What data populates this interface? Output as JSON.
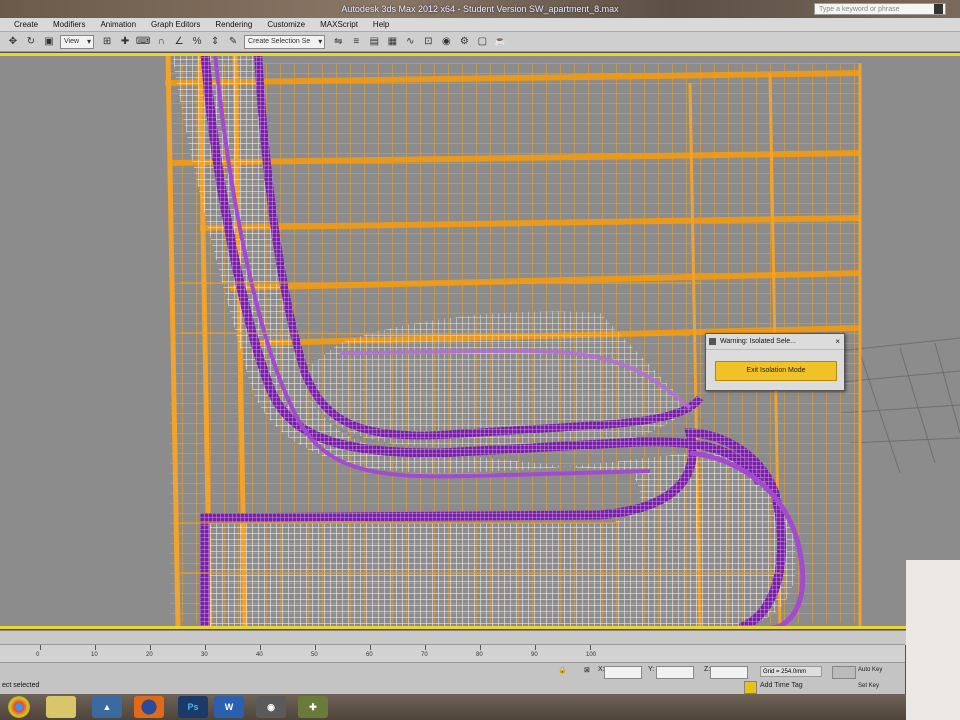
{
  "window": {
    "title": "Autodesk 3ds Max  2012 x64    - Student Version     SW_apartment_8.max"
  },
  "help_search": {
    "placeholder": "Type a keyword or phrase"
  },
  "menubar": {
    "items": [
      "Create",
      "Modifiers",
      "Animation",
      "Graph Editors",
      "Rendering",
      "Customize",
      "MAXScript",
      "Help"
    ]
  },
  "toolbar": {
    "view_dropdown": "View",
    "selection_set": "Create Selection Se"
  },
  "isolation_dialog": {
    "title": "Warning: Isolated Sele...",
    "close_label": "×",
    "button_label": "Exit Isolation Mode"
  },
  "timeline": {
    "ticks": [
      "0",
      "10",
      "20",
      "30",
      "40",
      "50",
      "60",
      "70",
      "80",
      "90",
      "100"
    ]
  },
  "statusbar": {
    "prompt": "ect selected",
    "x_label": "X:",
    "y_label": "Y:",
    "z_label": "Z:",
    "grid": "Grid = 254.0mm",
    "time_tag": "Add Time Tag",
    "auto_key": "Auto Key",
    "set_key": "Set Key"
  },
  "taskbar": {
    "apps": [
      "chrome",
      "folder",
      "3dsmax",
      "firefox",
      "photoshop",
      "word",
      "app",
      "app2"
    ],
    "ps_label": "Ps",
    "word_label": "W"
  },
  "colors": {
    "viewport_bg": "#8c8c8c",
    "highlight": "#e9d630",
    "wire_orange": "#f0a020",
    "wire_purple": "#8a2bb0",
    "wire_white": "#f4f0f8"
  }
}
